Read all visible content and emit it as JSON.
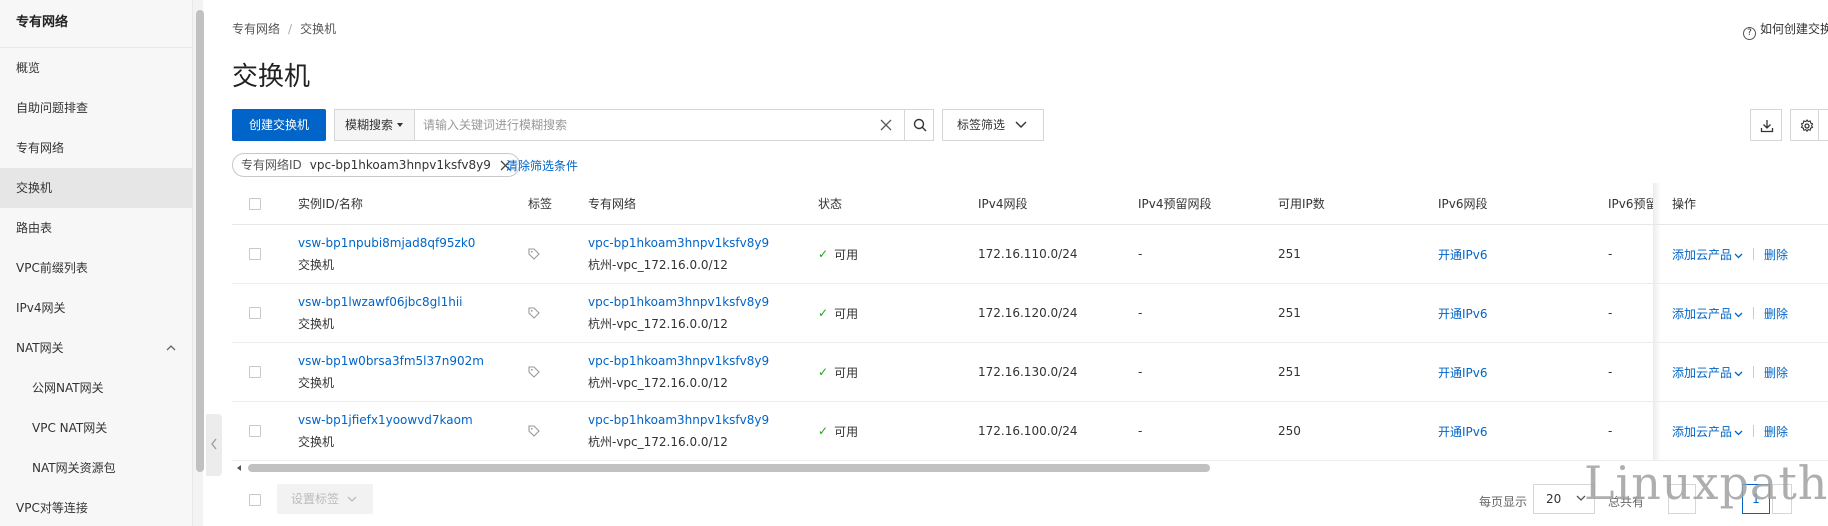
{
  "sidebar": {
    "title": "专有网络",
    "items": [
      {
        "label": "概览"
      },
      {
        "label": "自助问题排查"
      },
      {
        "label": "专有网络"
      },
      {
        "label": "交换机"
      },
      {
        "label": "路由表"
      },
      {
        "label": "VPC前缀列表"
      },
      {
        "label": "IPv4网关"
      },
      {
        "label": "NAT网关"
      },
      {
        "label": "公网NAT网关"
      },
      {
        "label": "VPC NAT网关"
      },
      {
        "label": "NAT网关资源包"
      },
      {
        "label": "VPC对等连接"
      }
    ],
    "active": "交换机"
  },
  "breadcrumb": {
    "root": "专有网络",
    "separator": "/",
    "current": "交换机"
  },
  "help": {
    "label": "如何创建交换"
  },
  "page": {
    "title": "交换机"
  },
  "toolbar": {
    "create_label": "创建交换机",
    "search_type": "模糊搜索",
    "search_placeholder": "请输入关键词进行模糊搜索",
    "tag_filter_label": "标签筛选"
  },
  "filters": {
    "chip_key": "专有网络ID",
    "chip_value": "vpc-bp1hkoam3hnpv1ksfv8y9",
    "clear_label": "清除筛选条件"
  },
  "table": {
    "headers": {
      "id": "实例ID/名称",
      "tag": "标签",
      "vpc": "专有网络",
      "status": "状态",
      "ipv4": "IPv4网段",
      "ipv4_reserved": "IPv4预留网段",
      "available_ip": "可用IP数",
      "ipv6": "IPv6网段",
      "ipv6_reserved": "IPv6预留",
      "ops": "操作"
    },
    "rows": [
      {
        "id": "vsw-bp1npubi8mjad8qf95zk0",
        "name": "交换机",
        "vpc_id": "vpc-bp1hkoam3hnpv1ksfv8y9",
        "vpc_name": "杭州-vpc_172.16.0.0/12",
        "status": "可用",
        "ipv4": "172.16.110.0/24",
        "ipv4_reserved": "-",
        "available_ip": "251",
        "ipv6": "开通IPv6",
        "ipv6_reserved": "-",
        "op_add": "添加云产品",
        "op_delete": "删除"
      },
      {
        "id": "vsw-bp1lwzawf06jbc8gl1hii",
        "name": "交换机",
        "vpc_id": "vpc-bp1hkoam3hnpv1ksfv8y9",
        "vpc_name": "杭州-vpc_172.16.0.0/12",
        "status": "可用",
        "ipv4": "172.16.120.0/24",
        "ipv4_reserved": "-",
        "available_ip": "251",
        "ipv6": "开通IPv6",
        "ipv6_reserved": "-",
        "op_add": "添加云产品",
        "op_delete": "删除"
      },
      {
        "id": "vsw-bp1w0brsa3fm5l37n902m",
        "name": "交换机",
        "vpc_id": "vpc-bp1hkoam3hnpv1ksfv8y9",
        "vpc_name": "杭州-vpc_172.16.0.0/12",
        "status": "可用",
        "ipv4": "172.16.130.0/24",
        "ipv4_reserved": "-",
        "available_ip": "251",
        "ipv6": "开通IPv6",
        "ipv6_reserved": "-",
        "op_add": "添加云产品",
        "op_delete": "删除"
      },
      {
        "id": "vsw-bp1jfiefx1yoowvd7kaom",
        "name": "交换机",
        "vpc_id": "vpc-bp1hkoam3hnpv1ksfv8y9",
        "vpc_name": "杭州-vpc_172.16.0.0/12",
        "status": "可用",
        "ipv4": "172.16.100.0/24",
        "ipv4_reserved": "-",
        "available_ip": "250",
        "ipv6": "开通IPv6",
        "ipv6_reserved": "-",
        "op_add": "添加云产品",
        "op_delete": "删除"
      }
    ]
  },
  "footer": {
    "set_tag_label": "设置标签",
    "page_size_label": "每页显示",
    "page_size": "20",
    "total_label": "总共有",
    "current_page": "1"
  },
  "watermark": "Linuxpath",
  "colors": {
    "primary": "#0064c8",
    "success": "#23a31a",
    "sidebar_bg": "#f7f7f7"
  }
}
